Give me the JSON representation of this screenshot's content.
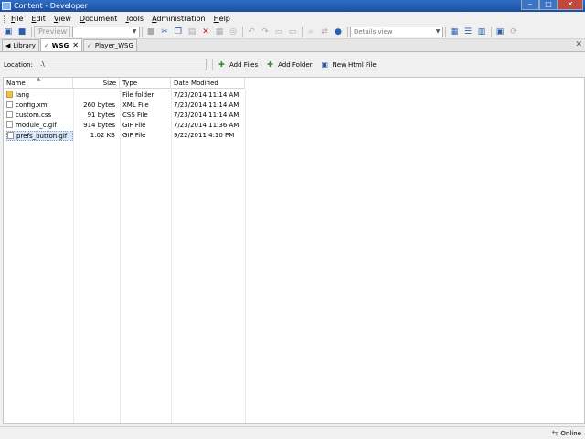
{
  "window": {
    "title": "Content - Developer",
    "min_glyph": "‒",
    "max_glyph": "□",
    "close_glyph": "✕"
  },
  "menu": [
    "File",
    "Edit",
    "View",
    "Document",
    "Tools",
    "Administration",
    "Help"
  ],
  "toolbar": {
    "preview_label": "Preview",
    "view_select": "Details view"
  },
  "tabs": [
    {
      "label": "Library",
      "active": false
    },
    {
      "label": "WSG",
      "active": true,
      "close": "✕"
    },
    {
      "label": "Player_WSG",
      "active": false
    }
  ],
  "tabbar_close": "✕",
  "location": {
    "label": "Location:",
    "value": ".\\"
  },
  "actions": {
    "add_files": "Add Files",
    "add_folder": "Add Folder",
    "new_html": "New Html File"
  },
  "columns": {
    "name": "Name",
    "size": "Size",
    "type": "Type",
    "date": "Date Modified"
  },
  "files": [
    {
      "name": "lang",
      "size": "",
      "type": "File folder",
      "date": "7/23/2014 11:14 AM",
      "kind": "folder"
    },
    {
      "name": "config.xml",
      "size": "260 bytes",
      "type": "XML File",
      "date": "7/23/2014 11:14 AM",
      "kind": "file"
    },
    {
      "name": "custom.css",
      "size": "91 bytes",
      "type": "CSS File",
      "date": "7/23/2014 11:14 AM",
      "kind": "file"
    },
    {
      "name": "module_c.gif",
      "size": "914 bytes",
      "type": "GIF File",
      "date": "7/23/2014 11:36 AM",
      "kind": "file"
    },
    {
      "name": "prefs_button.gif",
      "size": "1.02 KB",
      "type": "GIF File",
      "date": "9/22/2011 4:10 PM",
      "kind": "file"
    }
  ],
  "status": {
    "online": "Online"
  }
}
